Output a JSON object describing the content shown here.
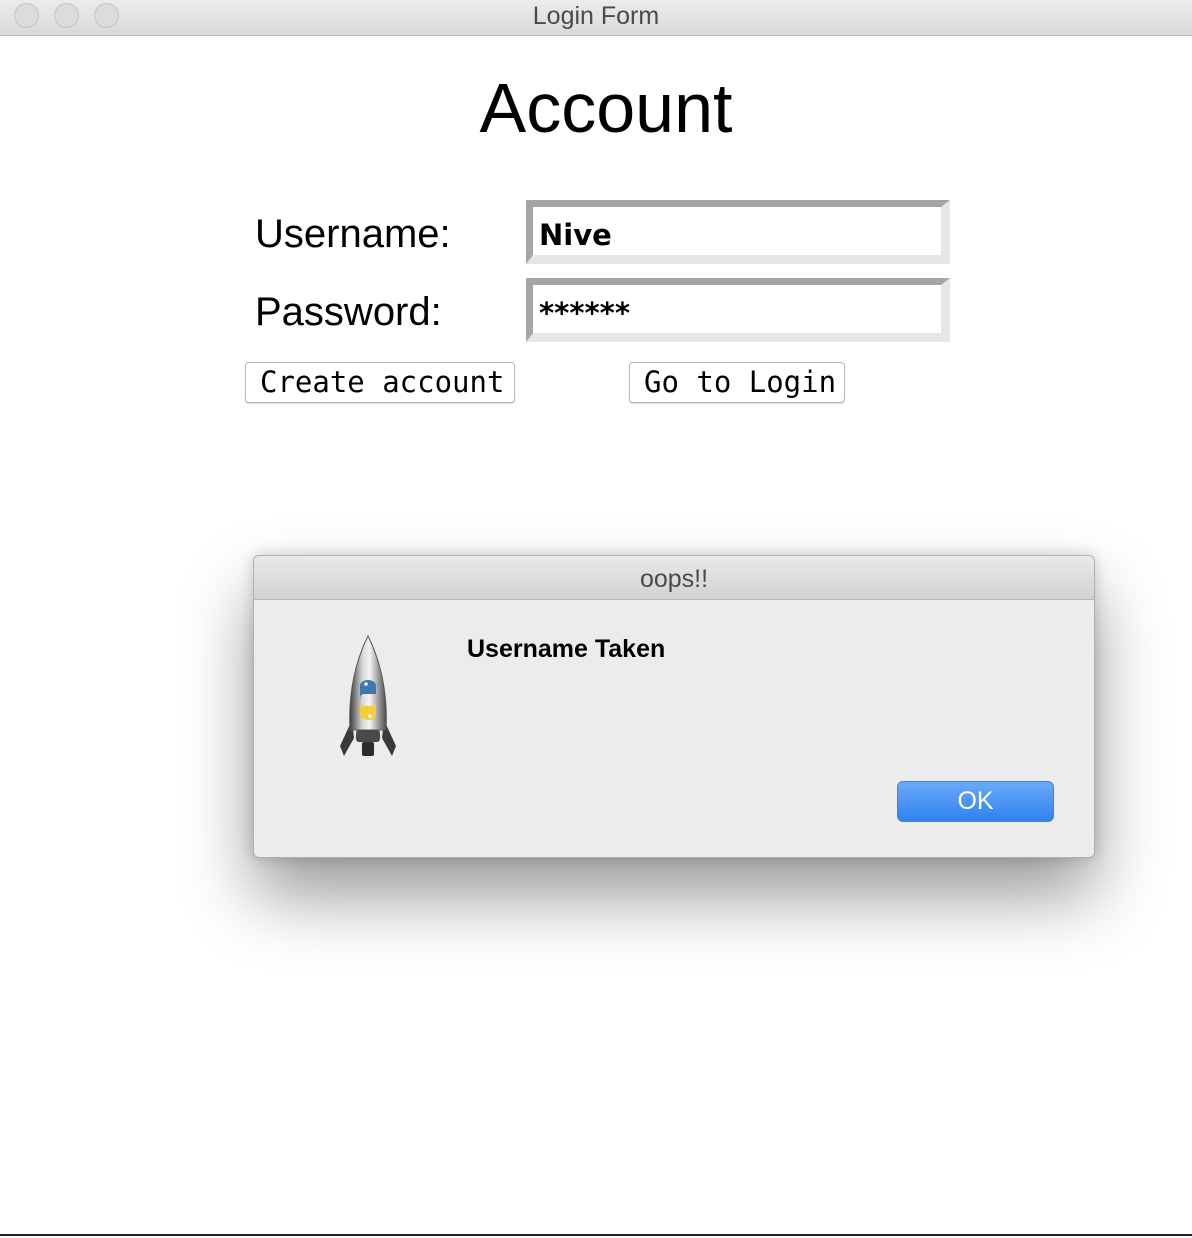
{
  "window": {
    "title": "Login Form"
  },
  "form": {
    "heading": "Account",
    "username_label": "Username:",
    "username_value": "Nive",
    "password_label": "Password:",
    "password_value": "******",
    "create_account_label": "Create account",
    "go_to_login_label": "Go to Login"
  },
  "dialog": {
    "title": "oops!!",
    "message": "Username Taken",
    "ok_label": "OK",
    "icon": "python-launcher-rocket-icon"
  },
  "colors": {
    "ok_button": "#3b87f2",
    "dialog_background": "#ececec"
  }
}
